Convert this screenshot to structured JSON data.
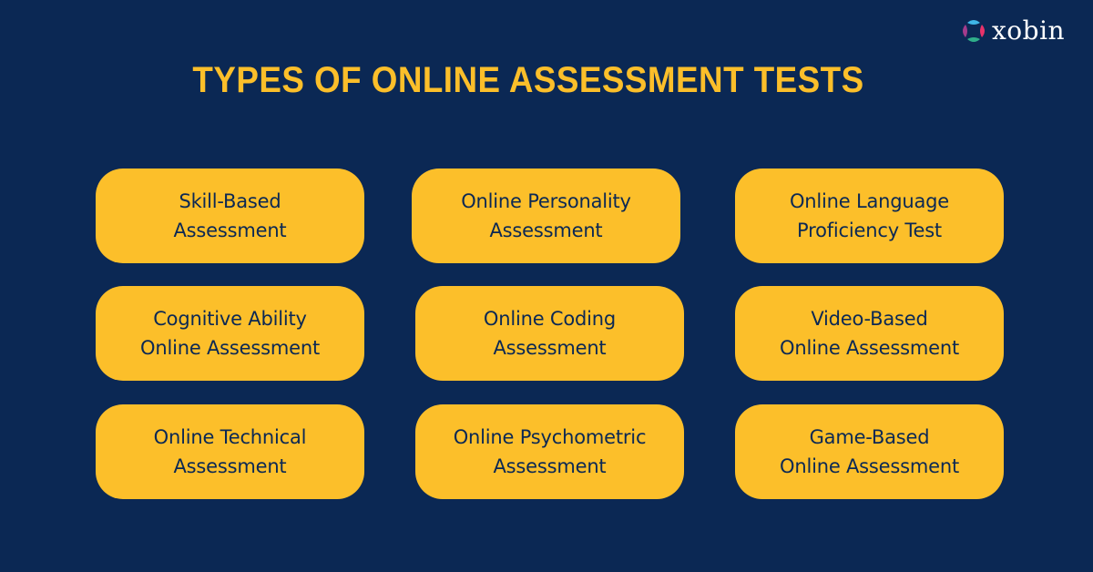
{
  "brand": {
    "name": "xobin",
    "icon": "xobin-logo-icon",
    "icon_colors": {
      "top": "#3fb6e8",
      "right": "#e8326a",
      "bottom": "#2fae8a",
      "left": "#a33c8c"
    }
  },
  "title": "TYPES OF ONLINE ASSESSMENT TESTS",
  "colors": {
    "background": "#0b2854",
    "accent": "#fcbf2a",
    "card_text": "#0b2854"
  },
  "cards": [
    {
      "label": "Skill-Based\nAssessment"
    },
    {
      "label": "Online Personality\nAssessment"
    },
    {
      "label": "Online Language\nProficiency Test"
    },
    {
      "label": "Cognitive Ability\nOnline Assessment"
    },
    {
      "label": "Online Coding\nAssessment"
    },
    {
      "label": "Video-Based\nOnline Assessment"
    },
    {
      "label": "Online Technical\nAssessment"
    },
    {
      "label": "Online Psychometric\nAssessment"
    },
    {
      "label": "Game-Based\nOnline Assessment"
    }
  ]
}
